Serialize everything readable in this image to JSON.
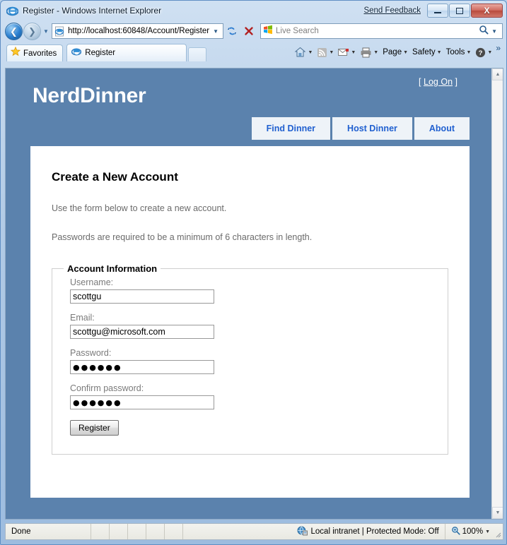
{
  "window": {
    "title": "Register - Windows Internet Explorer",
    "send_feedback": "Send Feedback",
    "minimize_label": "Minimize",
    "maximize_label": "Maximize",
    "close_label": "X"
  },
  "address_bar": {
    "url": "http://localhost:60848/Account/Register",
    "back_label": "Back",
    "forward_label": "Forward",
    "refresh_label": "Refresh",
    "stop_label": "Stop"
  },
  "search": {
    "placeholder": "Live Search"
  },
  "tabs": {
    "favorites_label": "Favorites",
    "items": [
      {
        "label": "Register"
      }
    ],
    "new_tab_label": ""
  },
  "command_bar": {
    "items": [
      {
        "label": "Page"
      },
      {
        "label": "Safety"
      },
      {
        "label": "Tools"
      }
    ],
    "overflow": "»"
  },
  "page": {
    "logon_open": "[",
    "logon_label": "Log On",
    "logon_close": "]",
    "site_title": "NerdDinner",
    "nav": [
      {
        "label": "Find Dinner"
      },
      {
        "label": "Host Dinner"
      },
      {
        "label": "About"
      }
    ],
    "heading": "Create a New Account",
    "intro_1": "Use the form below to create a new account.",
    "intro_2": "Passwords are required to be a minimum of 6 characters in length.",
    "fieldset_legend": "Account Information",
    "fields": [
      {
        "label": "Username:",
        "value": "scottgu",
        "type": "text"
      },
      {
        "label": "Email:",
        "value": "scottgu@microsoft.com",
        "type": "text"
      },
      {
        "label": "Password:",
        "value": "●●●●●●",
        "type": "password"
      },
      {
        "label": "Confirm password:",
        "value": "●●●●●●",
        "type": "password"
      }
    ],
    "submit_label": "Register"
  },
  "status_bar": {
    "status": "Done",
    "zone": "Local intranet | Protected Mode: Off",
    "zoom": "100%"
  },
  "colors": {
    "header_blue": "#5b82ad",
    "nav_link_blue": "#2060d0",
    "nav_tab_bg": "#eef3f8",
    "muted_text": "#6b6b6b",
    "close_button_red": "#b84a3d"
  }
}
